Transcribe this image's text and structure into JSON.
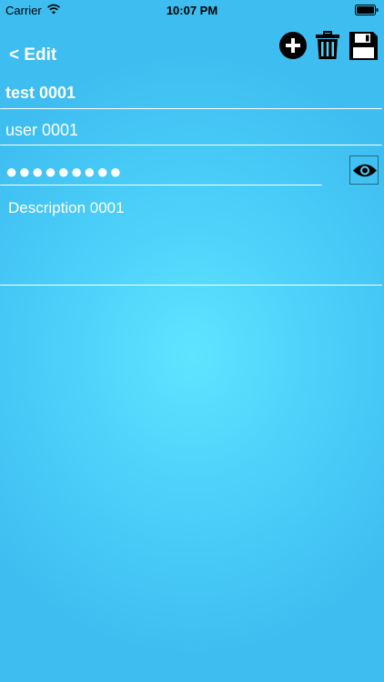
{
  "status_bar": {
    "carrier": "Carrier",
    "time": "10:07 PM"
  },
  "nav": {
    "back_label": "< Edit"
  },
  "toolbar": {
    "add_icon": "plus-circle-icon",
    "delete_icon": "trash-icon",
    "save_icon": "floppy-disk-icon"
  },
  "form": {
    "title_value": "test 0001",
    "username_value": "user 0001",
    "password_masked": "●●●●●●●●●",
    "show_password_icon": "eye-icon",
    "description_value": "Description 0001"
  },
  "colors": {
    "background_center": "#5fe4ff",
    "background_edge": "#3dbdf0",
    "text": "#ffffff",
    "icons": "#000000"
  }
}
